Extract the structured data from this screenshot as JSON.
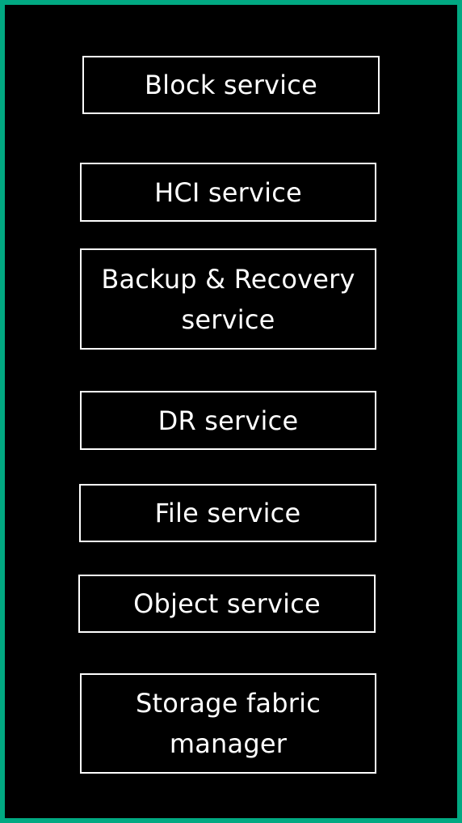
{
  "diagram": {
    "accent_color": "#01A982",
    "background_color": "#000000",
    "box_border_color": "#FFFFFF",
    "text_color": "#FFFFFF",
    "services": {
      "block": "Block service",
      "hci": "HCI service",
      "backup_recovery": "Backup & Recovery\nservice",
      "dr": "DR service",
      "file": "File service",
      "object": "Object service",
      "storage_fabric": "Storage fabric\nmanager"
    }
  }
}
